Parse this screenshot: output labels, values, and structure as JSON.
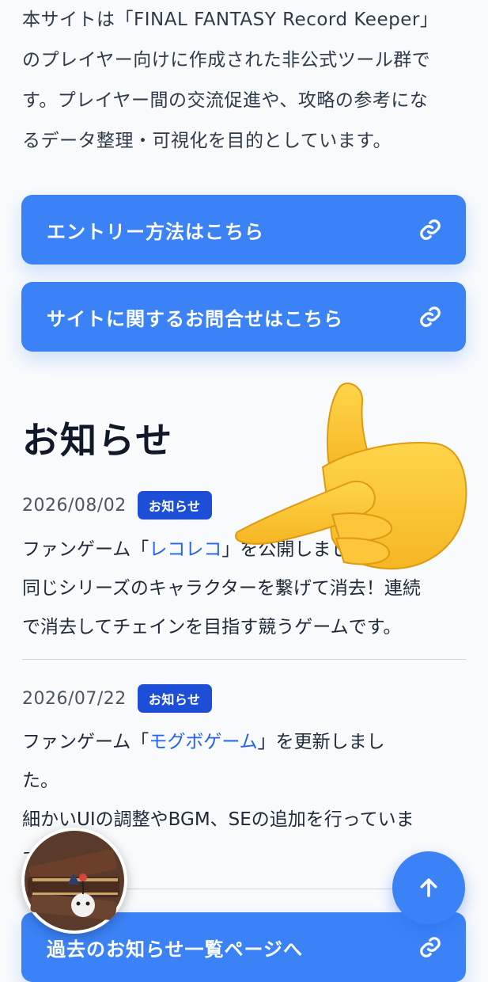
{
  "intro": {
    "lines": [
      "本サイトは「FINAL FANTASY Record Keeper」",
      "のプレイヤー向けに作成された非公式ツール群で",
      "す。プレイヤー間の交流促進や、攻略の参考にな",
      "るデータ整理・可視化を目的としています。"
    ]
  },
  "buttons": {
    "entry_label": "エントリー方法はこちら",
    "contact_label": "サイトに関するお問合せはこちら",
    "archive_label": "過去のお知らせ一覧ページへ",
    "icon": "link-icon"
  },
  "news": {
    "heading": "お知らせ",
    "items": [
      {
        "date": "2026/08/02",
        "badge": "お知らせ",
        "line1_pre": "ファンゲーム「",
        "link": "レコレコ",
        "line1_post": "」を公開しました。",
        "line2": "同じシリーズのキャラクターを繋げて消去！連続",
        "line3": "で消去してチェインを目指す競うゲームです。"
      },
      {
        "date": "2026/07/22",
        "badge": "お知らせ",
        "line1_pre": "ファンゲーム「",
        "link": "モグボゲーム",
        "line1_post": "」を更新しまし",
        "line2": "た。",
        "line3": "細かいUIの調整やBGM、SEの追加を行っていま",
        "line4": "す。"
      }
    ]
  },
  "scroll_top_icon": "arrow-up-icon",
  "avatar_icon": "moogle-book-avatar",
  "overlay_icon": "pointing-hand-emoji",
  "colors": {
    "accent": "#3b82f6",
    "badge": "#1d4ed8",
    "link": "#2563eb",
    "background": "#f8fafc"
  }
}
